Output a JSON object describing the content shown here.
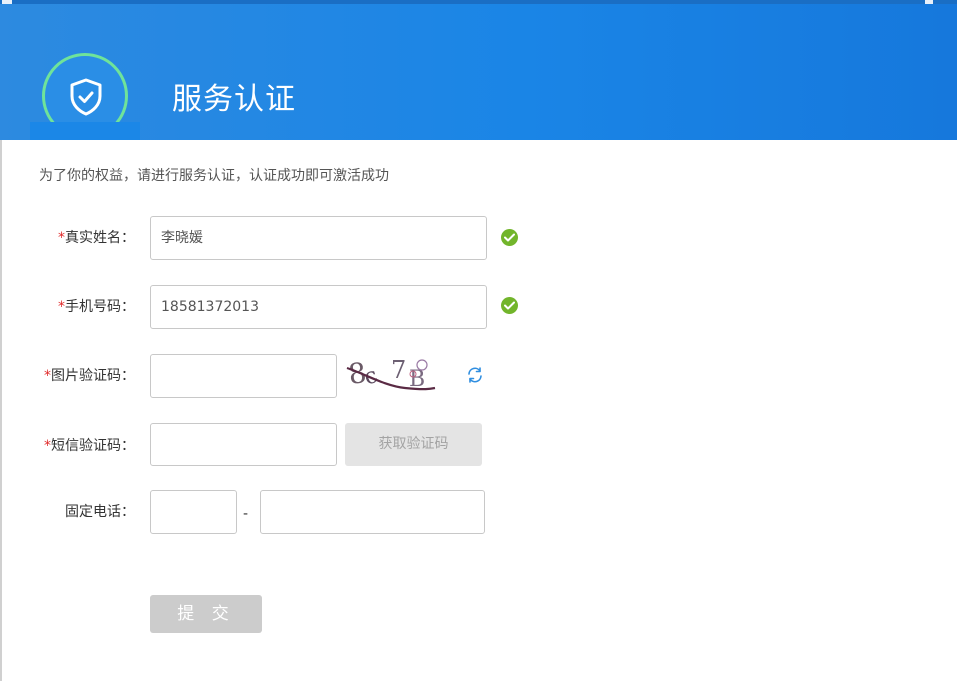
{
  "header": {
    "title": "服务认证",
    "logo_icon": "shield-check-icon"
  },
  "intro": "为了你的权益，请进行服务认证，认证成功即可激活成功",
  "form": {
    "required_mark": "*",
    "real_name": {
      "label": "真实姓名：",
      "value": "李晓媛",
      "valid": true
    },
    "mobile": {
      "label": "手机号码：",
      "value": "18581372013",
      "valid": true
    },
    "image_code": {
      "label": "图片验证码：",
      "value": "",
      "captcha_text": "8c7B",
      "refresh_icon": "refresh-icon"
    },
    "sms_code": {
      "label": "短信验证码：",
      "value": "",
      "button": "获取验证码"
    },
    "landline": {
      "label": "固定电话：",
      "area_value": "",
      "number_value": "",
      "separator": "-"
    },
    "submit": "提 交"
  },
  "colors": {
    "header_blue": "#1a85e6",
    "valid_green": "#72b52b",
    "required_red": "#e02a2a"
  }
}
